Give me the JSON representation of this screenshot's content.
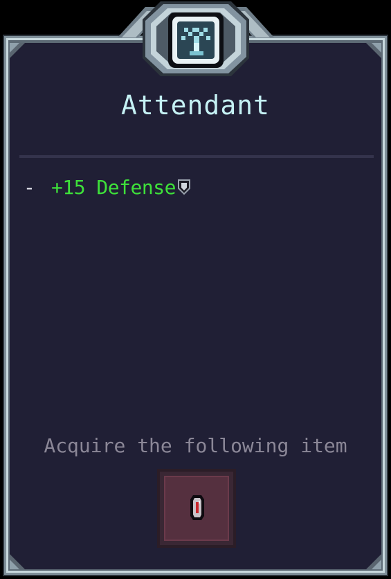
{
  "title": "Attendant",
  "bonuses": [
    {
      "bullet": "-",
      "text": "+15 Defense",
      "icon": "shield-icon"
    }
  ],
  "acquire_text": "Acquire the following item",
  "item": {
    "icon": "red-gem-item-icon"
  },
  "colors": {
    "panel_bg": "#201f35",
    "title": "#c5f1f4",
    "bonus_green": "#3ee13a",
    "acquire_gray": "#8b8797",
    "item_slot": "#55303f"
  }
}
